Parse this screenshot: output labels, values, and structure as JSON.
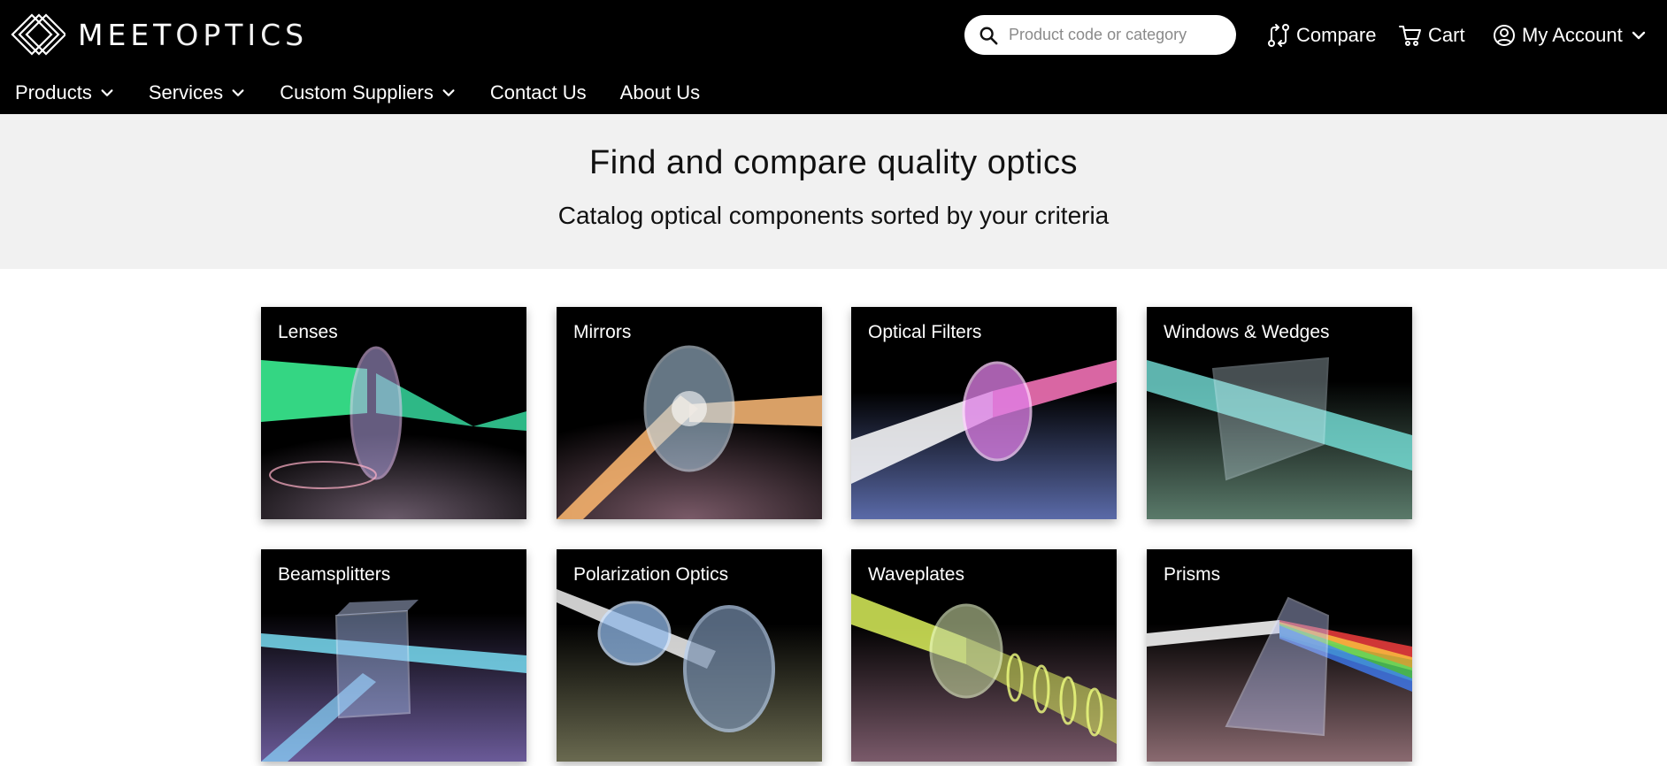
{
  "header": {
    "logo_text_bold": "MEET",
    "logo_text_light": "OPTICS",
    "search": {
      "placeholder": "Product code or category",
      "icon": "search-icon"
    },
    "compare_label": "Compare",
    "cart_label": "Cart",
    "account_label": "My Account"
  },
  "nav": {
    "items": [
      {
        "label": "Products",
        "has_dropdown": true
      },
      {
        "label": "Services",
        "has_dropdown": true
      },
      {
        "label": "Custom Suppliers",
        "has_dropdown": true
      },
      {
        "label": "Contact Us",
        "has_dropdown": false
      },
      {
        "label": "About Us",
        "has_dropdown": false
      }
    ]
  },
  "hero": {
    "title": "Find and compare quality optics",
    "subtitle": "Catalog optical components sorted by your criteria"
  },
  "categories": [
    {
      "label": "Lenses"
    },
    {
      "label": "Mirrors"
    },
    {
      "label": "Optical Filters"
    },
    {
      "label": "Windows & Wedges"
    },
    {
      "label": "Beamsplitters"
    },
    {
      "label": "Polarization Optics"
    },
    {
      "label": "Waveplates"
    },
    {
      "label": "Prisms"
    }
  ],
  "colors": {
    "header_bg": "#000000",
    "hero_bg": "#f1f1f1",
    "card_bg": "#000000"
  }
}
